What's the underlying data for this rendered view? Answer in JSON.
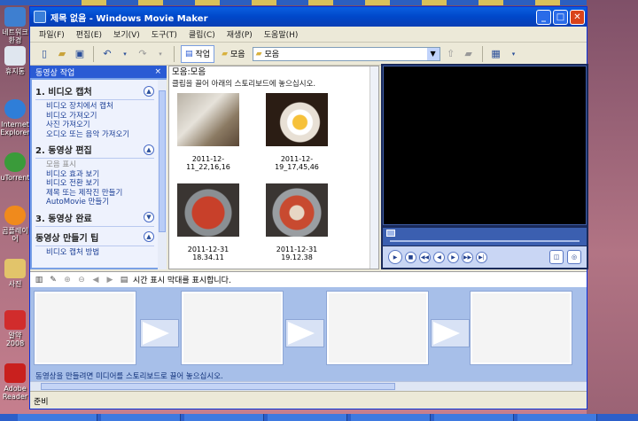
{
  "desktop": {
    "icons": [
      {
        "label": "네트워크 환경"
      },
      {
        "label": "휴지통"
      },
      {
        "label": "Internet Explorer"
      },
      {
        "label": "uTorrent"
      },
      {
        "label": "곰플레이어"
      },
      {
        "label": "사진"
      },
      {
        "label": "알약 2008"
      },
      {
        "label": "Adobe Reader"
      }
    ]
  },
  "window": {
    "title": "제목 없음 - Windows Movie Maker"
  },
  "menu": [
    "파일(F)",
    "편집(E)",
    "보기(V)",
    "도구(T)",
    "클립(C)",
    "재생(P)",
    "도움말(H)"
  ],
  "toolbar": {
    "tasks_label": "작업",
    "collections_label": "모음",
    "collection_combo_value": "모음"
  },
  "tasks_pane": {
    "header": "동영상 작업",
    "close": "×",
    "sections": [
      {
        "title": "1. 비디오 캡처",
        "links": [
          {
            "label": "비디오 장치에서 캡처",
            "enabled": true
          },
          {
            "label": "비디오 가져오기",
            "enabled": true
          },
          {
            "label": "사진 가져오기",
            "enabled": true
          },
          {
            "label": "오디오 또는 음악 가져오기",
            "enabled": true
          }
        ]
      },
      {
        "title": "2. 동영상 편집",
        "links": [
          {
            "label": "모음 표시",
            "enabled": false
          },
          {
            "label": "비디오 효과 보기",
            "enabled": true
          },
          {
            "label": "비디오 전환 보기",
            "enabled": true
          },
          {
            "label": "제목 또는 제작진 만들기",
            "enabled": true
          },
          {
            "label": "AutoMovie 만들기",
            "enabled": true
          }
        ]
      },
      {
        "title": "3. 동영상 완료",
        "links": []
      },
      {
        "title": "동영상 만들기 팁",
        "links": [
          {
            "label": "비디오 캡처 방법",
            "enabled": true
          }
        ]
      }
    ]
  },
  "collection": {
    "heading": "모음:모음",
    "instruction": "클립을 끌어 아래의 스토리보드에 놓으십시오.",
    "clips": [
      {
        "name": "2011-12-11_22,16,16"
      },
      {
        "name": "2011-12-19_17,45,46"
      },
      {
        "name": "2011-12-31 18.34.11"
      },
      {
        "name": "2011-12-31 19.12.38"
      }
    ]
  },
  "storyboard": {
    "timeline_hint": "시간 표시 막대를 표시합니다.",
    "message": "동영상을 만들려면 미디어를 스토리보드로 끌어 놓으십시오."
  },
  "status": {
    "text": "준비"
  }
}
